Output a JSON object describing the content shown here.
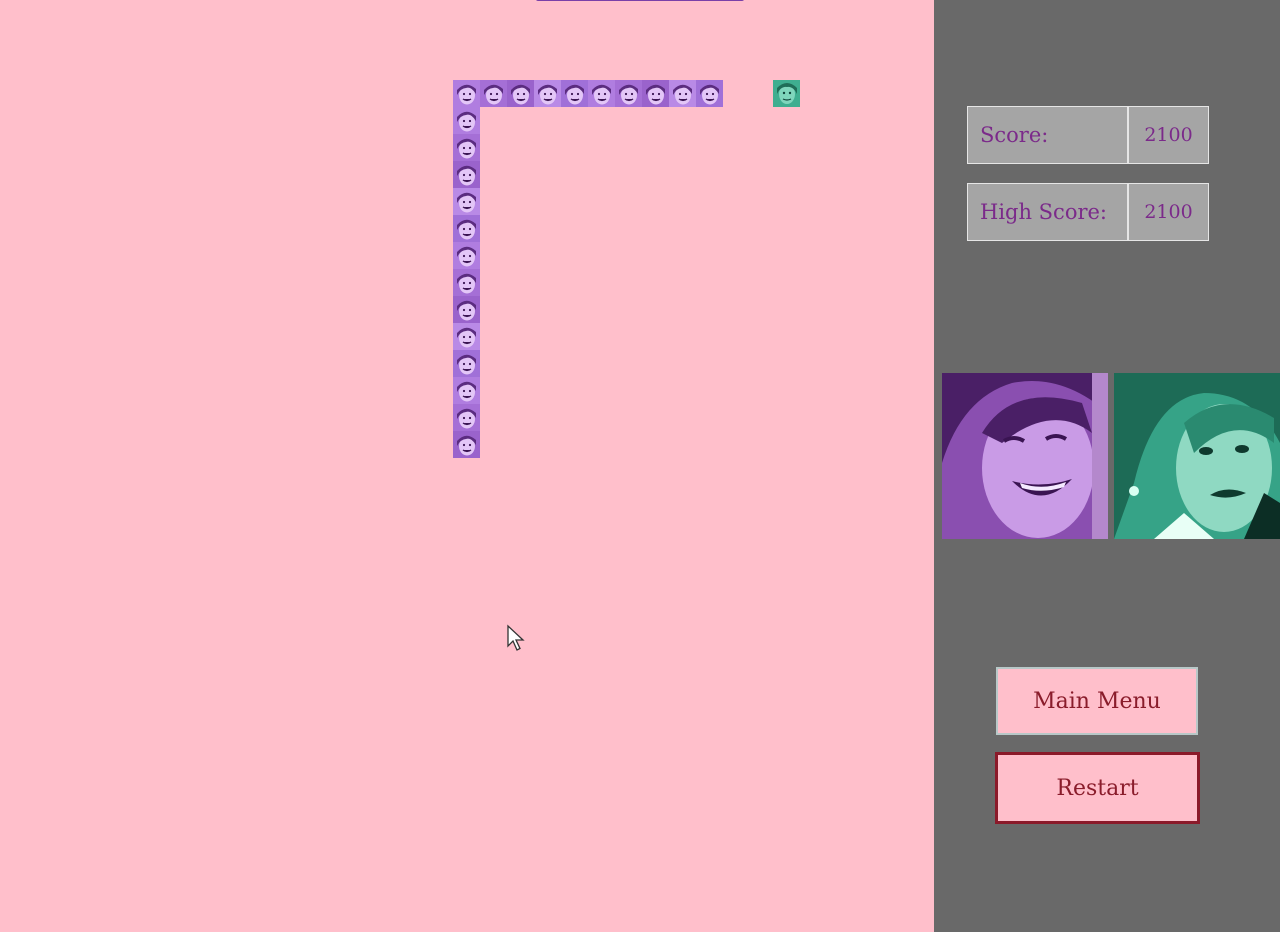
{
  "game": {
    "snake_length": 23,
    "snake_color": "#b07de0",
    "food_color": "#3fae90",
    "background_color": "#ffbfcb",
    "cursor_icon": "arrow-cursor-icon"
  },
  "sidebar": {
    "score_label": "Score:",
    "score_value": "2100",
    "high_score_label": "High Score:",
    "high_score_value": "2100",
    "player_portrait_color": "#8a4fb0",
    "food_portrait_color": "#36a387",
    "main_menu_label": "Main Menu",
    "restart_label": "Restart"
  }
}
